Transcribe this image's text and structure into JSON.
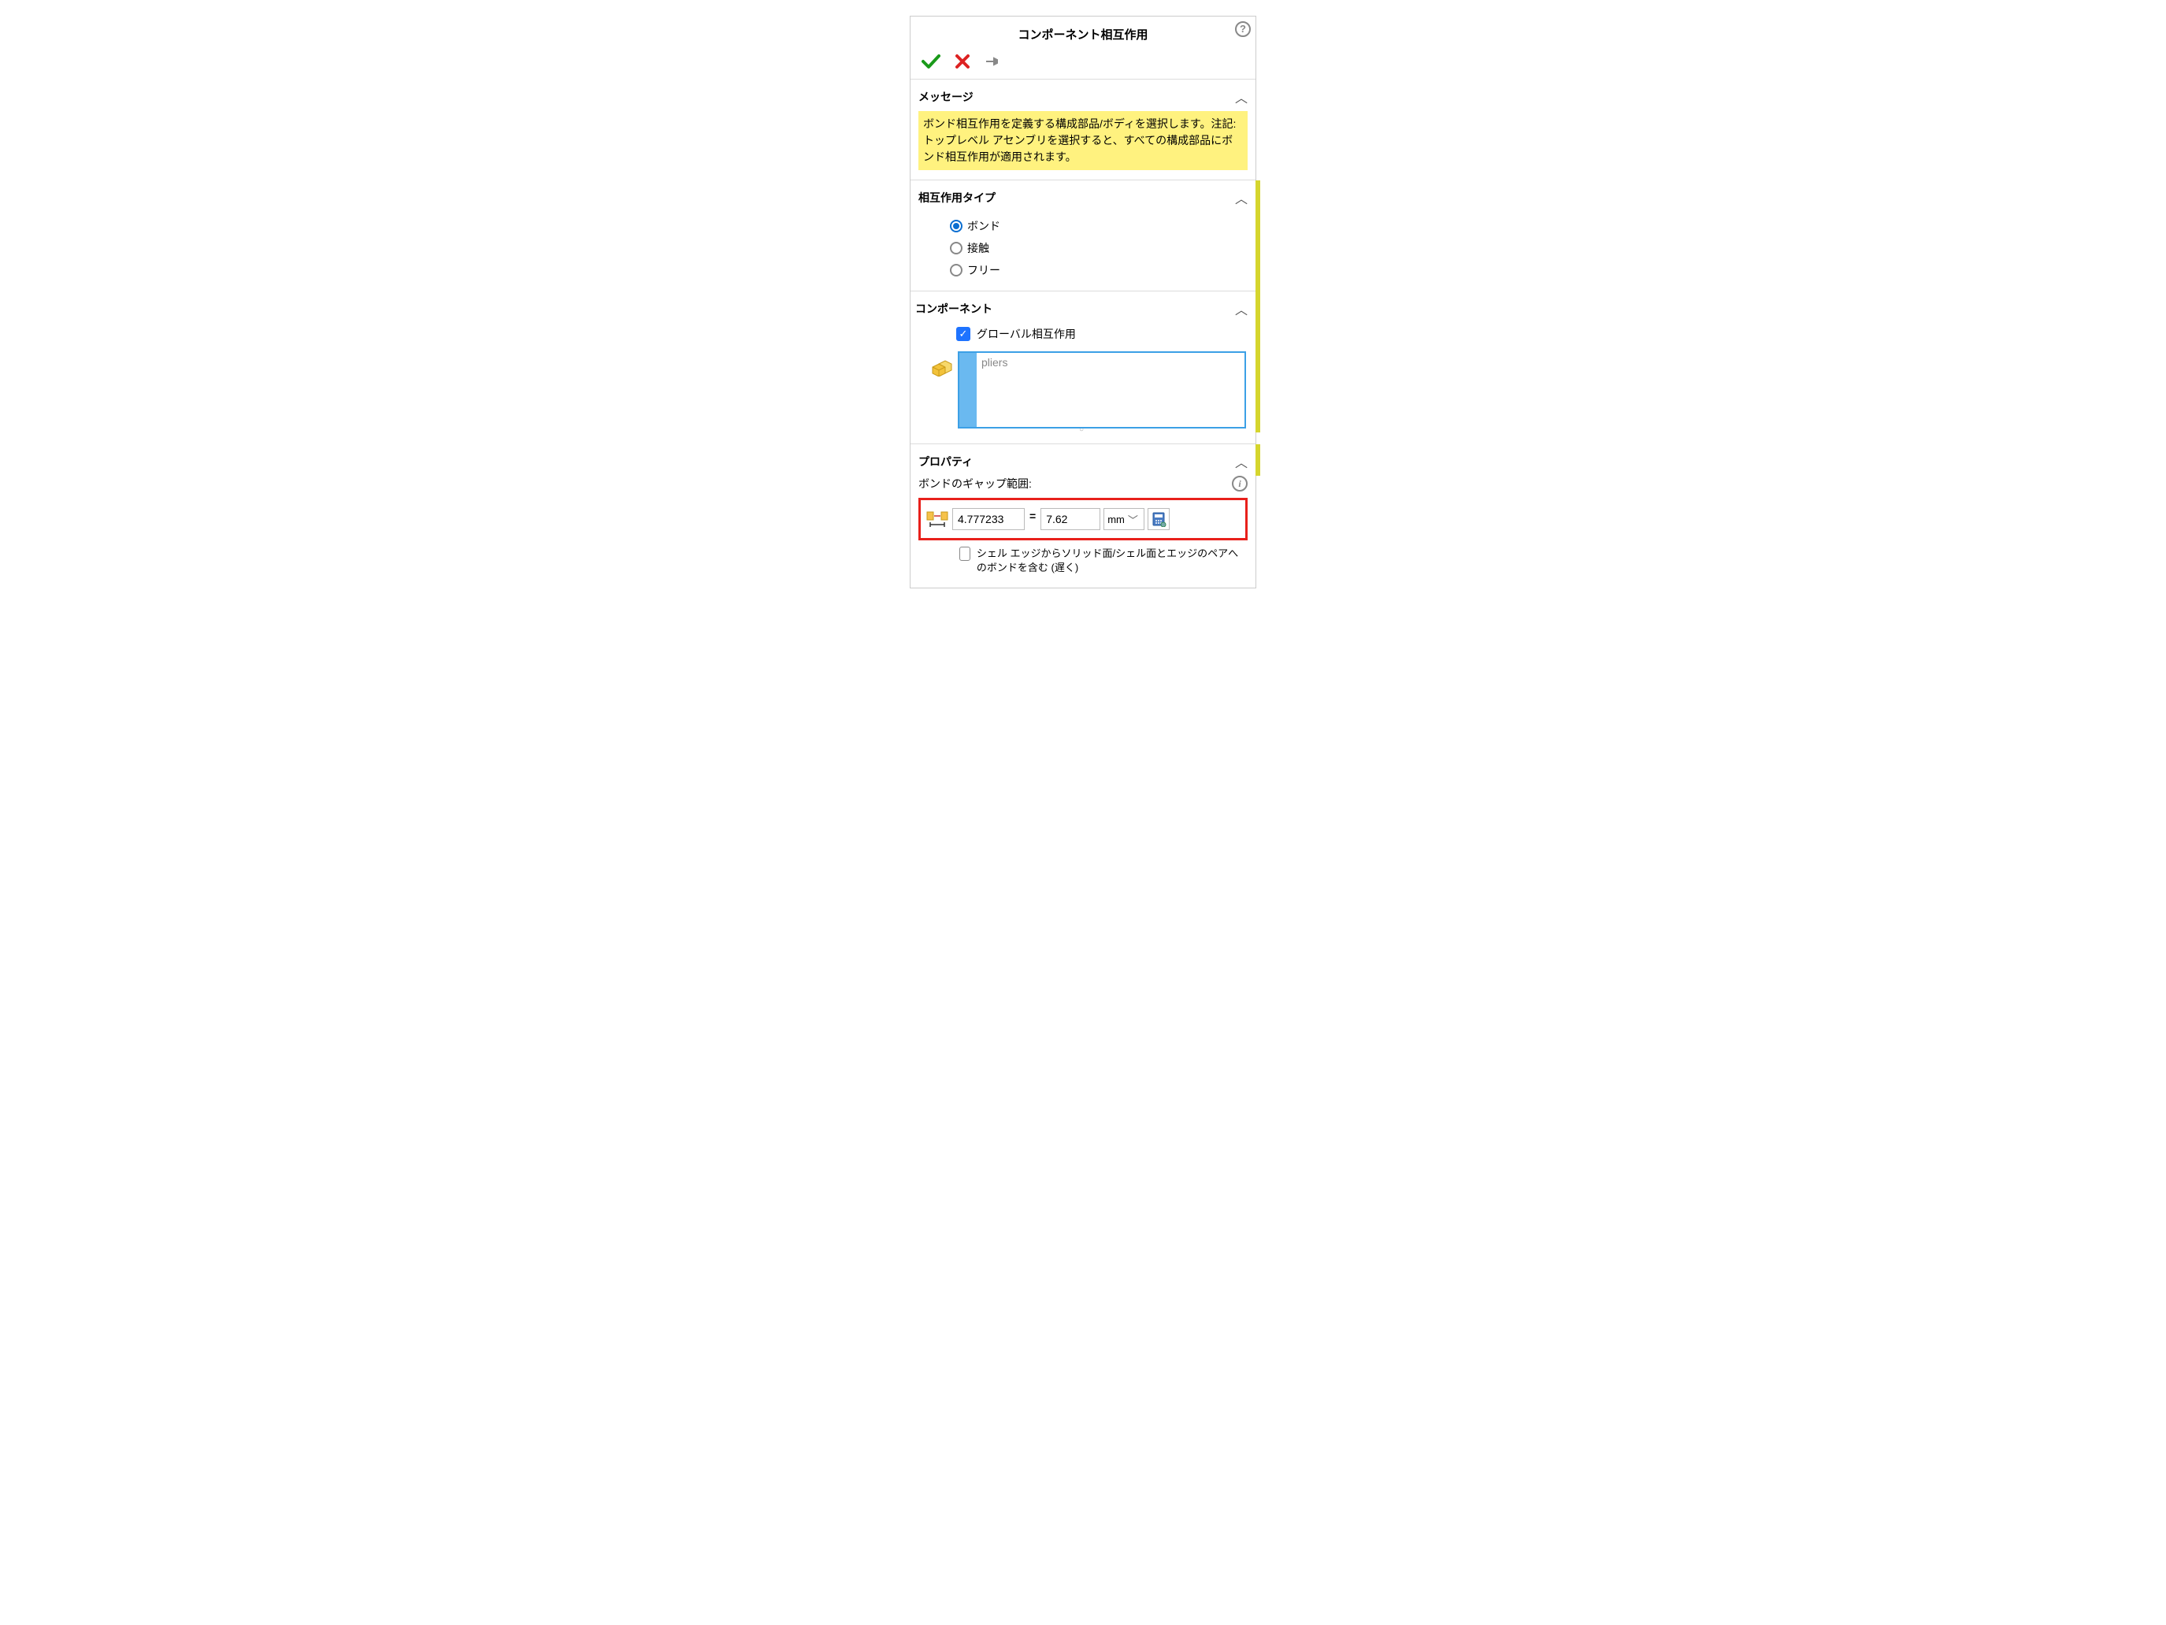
{
  "header": {
    "title": "コンポーネント相互作用"
  },
  "sections": {
    "message": {
      "title": "メッセージ",
      "body": "ボンド相互作用を定義する構成部品/ボディを選択します。注記: トップレベル アセンブリを選択すると、すべての構成部品にボンド相互作用が適用されます。"
    },
    "interaction_type": {
      "title": "相互作用タイプ",
      "options": {
        "bond": "ボンド",
        "contact": "接触",
        "free": "フリー"
      }
    },
    "component": {
      "title": "コンポーネント",
      "global_label": "グローバル相互作用",
      "selection_item": "pliers"
    },
    "property": {
      "title": "プロパティ",
      "gap_label": "ボンドのギャップ範囲:",
      "value1": "4.777233",
      "value2": "7.62",
      "unit": "mm",
      "shell_label": "シェル エッジからソリッド面/シェル面とエッジのペアへのボンドを含む (遅く)"
    }
  }
}
